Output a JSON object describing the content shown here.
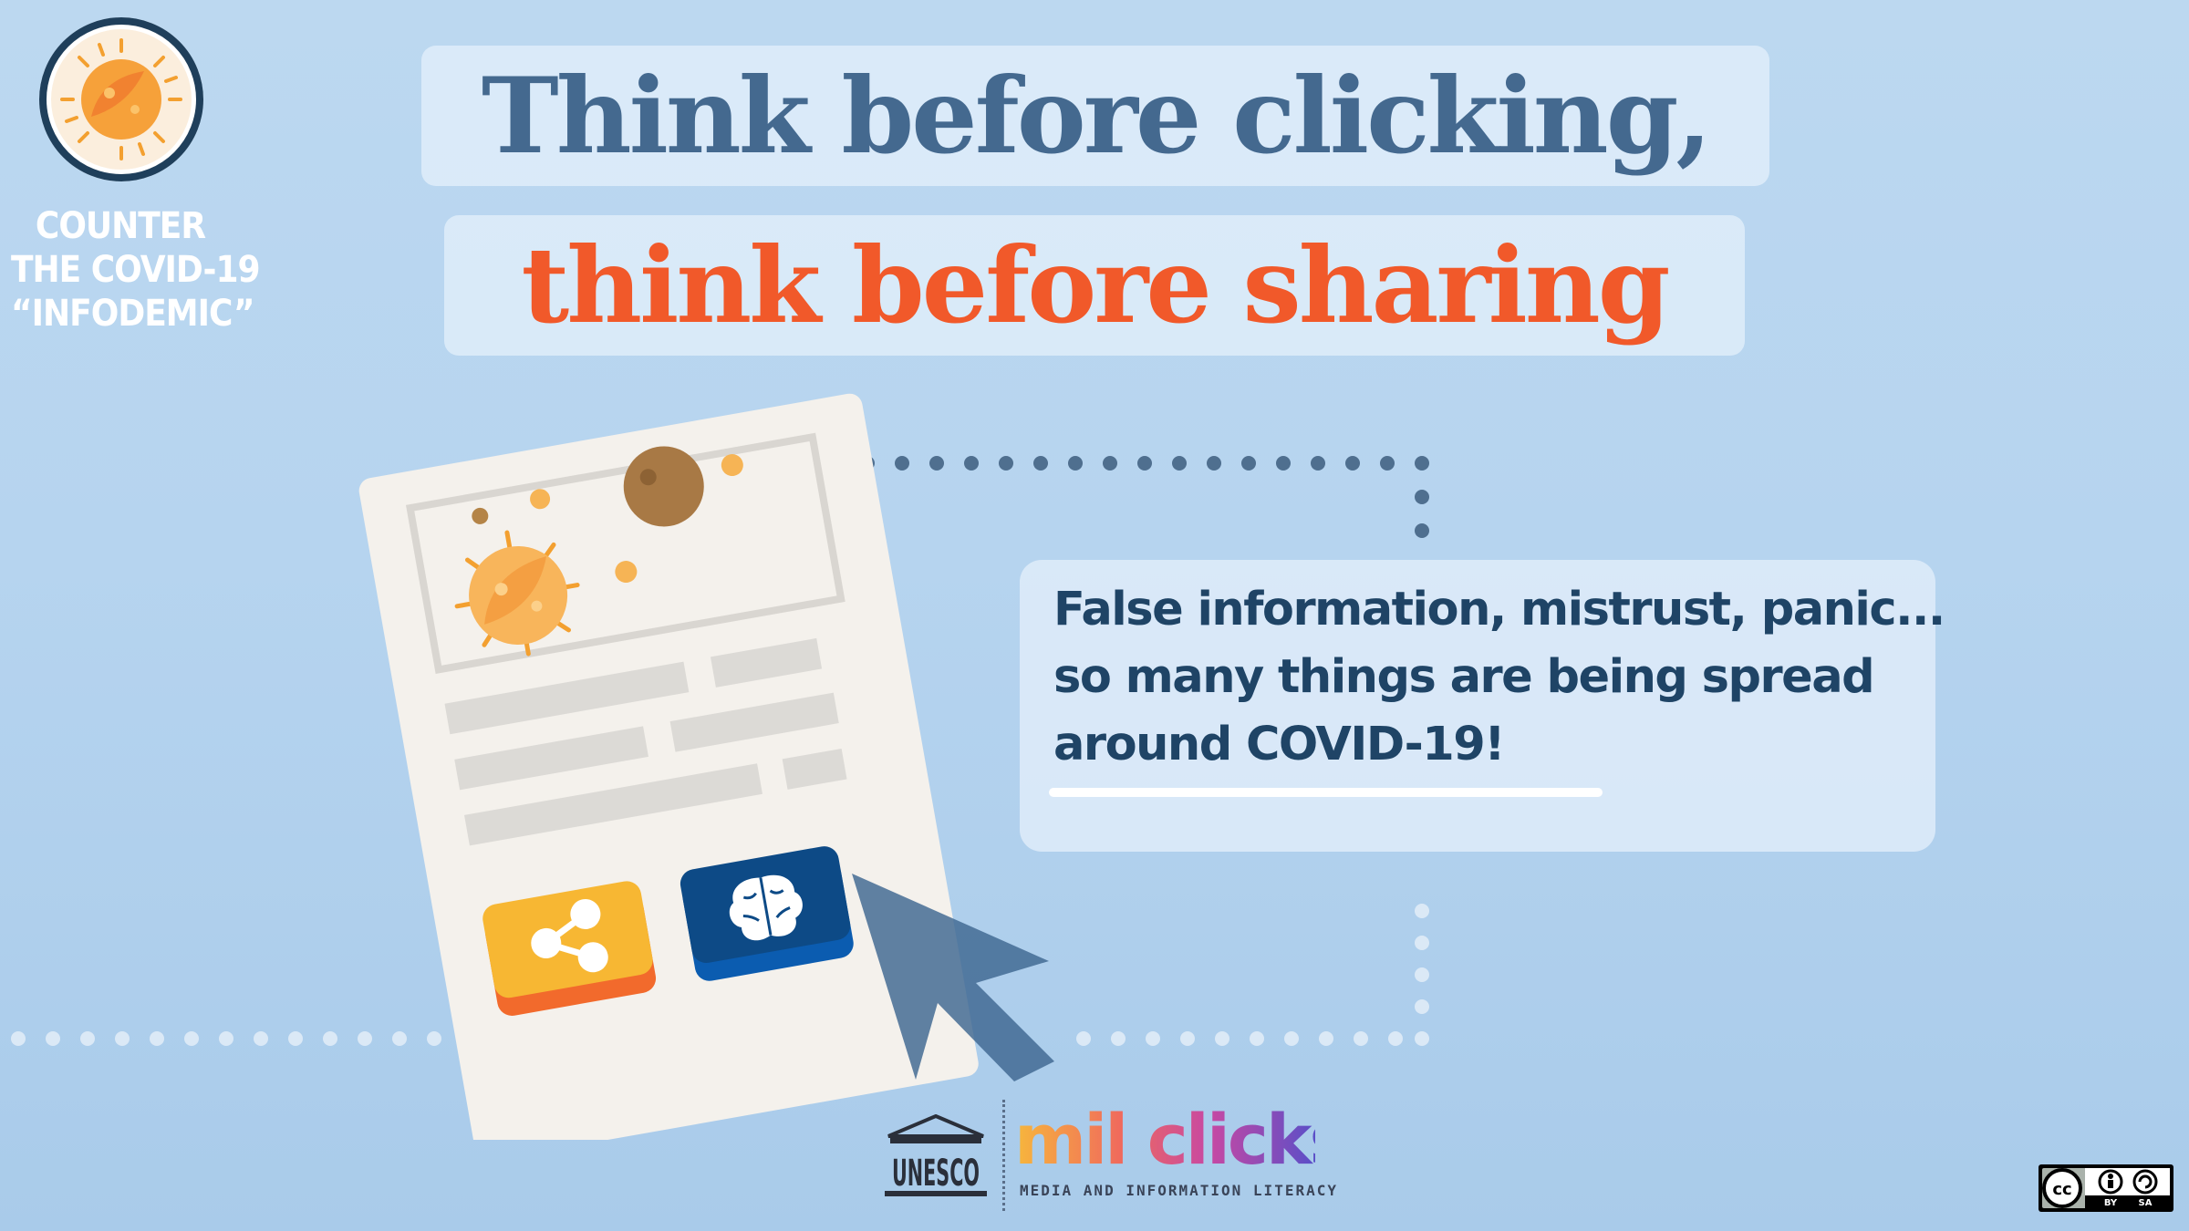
{
  "badge": {
    "lines": [
      "COUNTER",
      "THE COVID-19",
      "“INFODEMIC”"
    ]
  },
  "headline": {
    "line1": "Think before clicking,",
    "line2": "think before sharing"
  },
  "message": {
    "lines": [
      "False information, mistrust, panic...",
      "so many things are being spread",
      "around COVID-19!"
    ]
  },
  "footer": {
    "unesco_text": "UNESCO",
    "milclicks_text": "mil clicks",
    "milclicks_tagline": "MEDIA AND INFORMATION LITERACY",
    "license_labels": [
      "BY",
      "SA"
    ]
  },
  "colors": {
    "headline_blue": "#44698f",
    "headline_orange": "#f1592a",
    "message_text": "#1f4466",
    "share_button": "#f7b733",
    "think_button": "#0d4d8f",
    "dots": "#4f6f8f"
  },
  "icons": {
    "badge": "virus-icon",
    "share": "share-icon",
    "think": "brain-icon",
    "pointer": "cursor-arrow-icon"
  }
}
